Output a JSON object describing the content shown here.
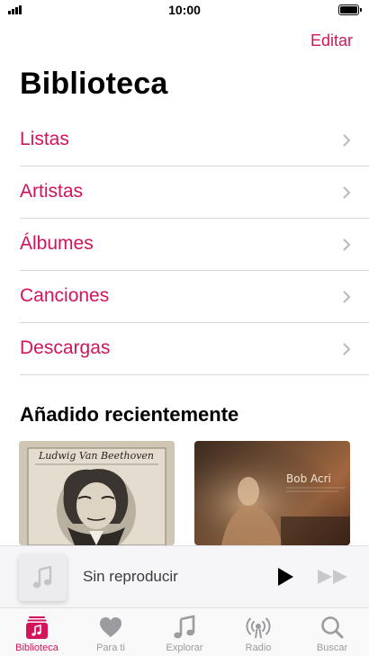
{
  "status_bar": {
    "time": "10:00"
  },
  "header": {
    "edit_label": "Editar",
    "title": "Biblioteca"
  },
  "library": {
    "items": [
      {
        "label": "Listas"
      },
      {
        "label": "Artistas"
      },
      {
        "label": "Álbumes"
      },
      {
        "label": "Canciones"
      },
      {
        "label": "Descargas"
      }
    ]
  },
  "recent": {
    "title": "Añadido recientemente",
    "albums": [
      {
        "cover_text": "Ludwig Van Beethoven"
      },
      {
        "cover_text": "Bob Acri"
      }
    ]
  },
  "mini_player": {
    "title": "Sin reproducir",
    "play_icon": "play-icon",
    "forward_icon": "fast-forward-icon"
  },
  "tab_bar": {
    "tabs": [
      {
        "label": "Biblioteca",
        "icon": "library-icon",
        "active": true
      },
      {
        "label": "Para ti",
        "icon": "heart-icon",
        "active": false
      },
      {
        "label": "Explorar",
        "icon": "music-note-icon",
        "active": false
      },
      {
        "label": "Radio",
        "icon": "radio-icon",
        "active": false
      },
      {
        "label": "Buscar",
        "icon": "search-icon",
        "active": false
      }
    ]
  },
  "colors": {
    "accent": "#d3135a",
    "inactive": "#9b9ba0",
    "separator": "#d8d8dc"
  }
}
